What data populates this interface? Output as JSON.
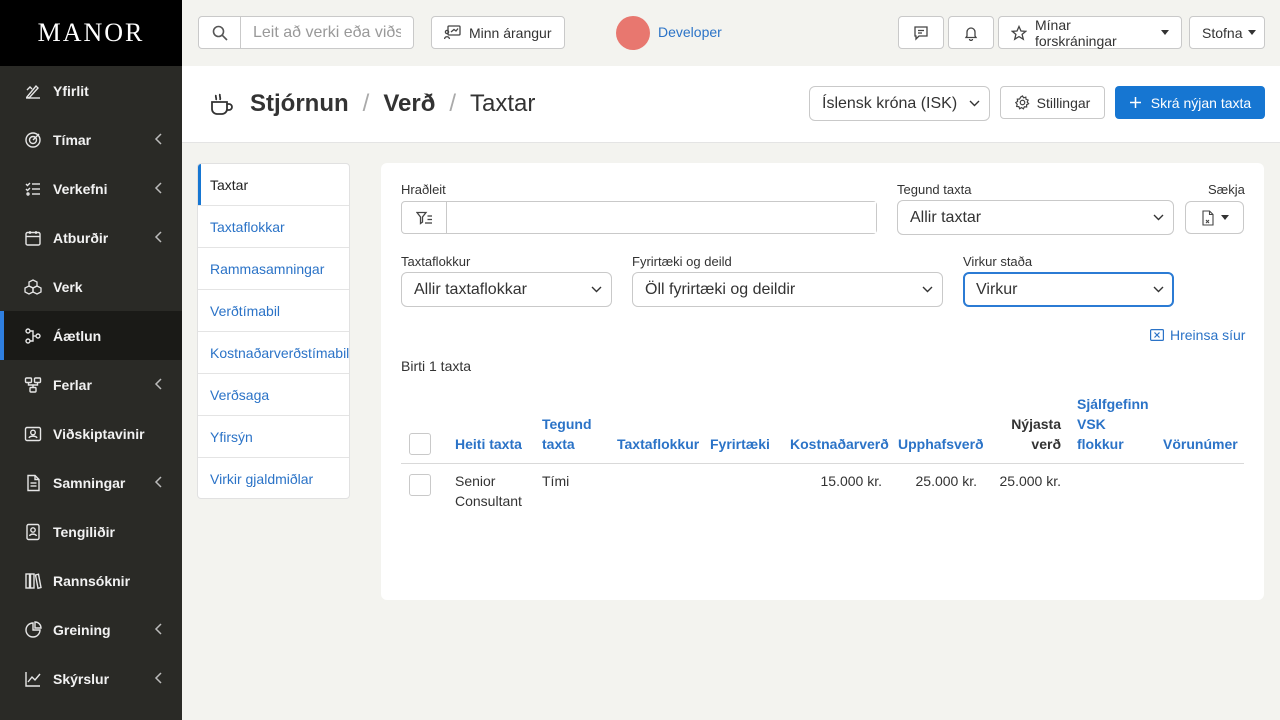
{
  "app": {
    "logo": "MANOR"
  },
  "sidebar": {
    "items": [
      {
        "label": "Yfirlit",
        "icon": "pen-chart-icon",
        "submenu": false
      },
      {
        "label": "Tímar",
        "icon": "target-clock-icon",
        "submenu": true
      },
      {
        "label": "Verkefni",
        "icon": "checklist-icon",
        "submenu": true
      },
      {
        "label": "Atburðir",
        "icon": "calendar-icon",
        "submenu": true
      },
      {
        "label": "Verk",
        "icon": "cubes-icon",
        "submenu": false
      },
      {
        "label": "Áætlun",
        "icon": "diagram-icon",
        "submenu": false,
        "active": true
      },
      {
        "label": "Ferlar",
        "icon": "flow-icon",
        "submenu": true
      },
      {
        "label": "Viðskiptavinir",
        "icon": "contacts-icon",
        "submenu": false
      },
      {
        "label": "Samningar",
        "icon": "document-icon",
        "submenu": true
      },
      {
        "label": "Tengiliðir",
        "icon": "address-book-icon",
        "submenu": false
      },
      {
        "label": "Rannsóknir",
        "icon": "books-icon",
        "submenu": false
      },
      {
        "label": "Greining",
        "icon": "analysis-icon",
        "submenu": true
      },
      {
        "label": "Skýrslur",
        "icon": "line-chart-icon",
        "submenu": true
      }
    ]
  },
  "topbar": {
    "search_placeholder": "Leit að verki eða viðskiptavini",
    "achievement_label": "Minn árangur",
    "user_name": "Developer",
    "registrations_label": "Mínar forskráningar",
    "create_label": "Stofna"
  },
  "header": {
    "crumbs": [
      "Stjórnun",
      "Verð",
      "Taxtar"
    ],
    "currency": "Íslensk króna (ISK)",
    "settings_label": "Stillingar",
    "new_rate_label": "Skrá nýjan taxta"
  },
  "subnav": {
    "items": [
      "Taxtar",
      "Taxtaflokkar",
      "Rammasamningar",
      "Verðtímabil",
      "Kostnaðarverðstímabil",
      "Verðsaga",
      "Yfirsýn",
      "Virkir gjaldmiðlar"
    ]
  },
  "filters": {
    "quick_label": "Hraðleit",
    "quick_value": "",
    "type_label": "Tegund taxta",
    "type_value": "Allir taxtar",
    "fetch_label": "Sækja",
    "category_label": "Taxtaflokkur",
    "category_value": "Allir taxtaflokkar",
    "company_label": "Fyrirtæki og deild",
    "company_value": "Öll fyrirtæki og deildir",
    "status_label": "Virkur staða",
    "status_value": "Virkur",
    "clear_label": "Hreinsa síur"
  },
  "results": {
    "count_text": "Birti 1 taxta"
  },
  "table": {
    "columns": {
      "name": [
        "Heiti taxta"
      ],
      "type": [
        "Tegund",
        "taxta"
      ],
      "category": [
        "Taxtaflokkur"
      ],
      "company": [
        "Fyrirtæki"
      ],
      "cost": [
        "Kostnaðarverð"
      ],
      "initial": [
        "Upphafsverð"
      ],
      "latest": [
        "Nýjasta",
        "verð"
      ],
      "vat": [
        "Sjálfgefinn",
        "VSK",
        "flokkur"
      ],
      "product": [
        "Vörunúmer"
      ]
    },
    "rows": [
      {
        "name": [
          "Senior",
          "Consultant"
        ],
        "type": "Tími",
        "category": "",
        "company": "",
        "cost": "15.000 kr.",
        "initial": "25.000 kr.",
        "latest": "25.000 kr.",
        "vat": "",
        "product": ""
      }
    ]
  },
  "colors": {
    "accent": "#1676d2",
    "link": "#2b73c7",
    "sidebar_bg": "#2a2a26",
    "avatar": "#e8776f"
  }
}
